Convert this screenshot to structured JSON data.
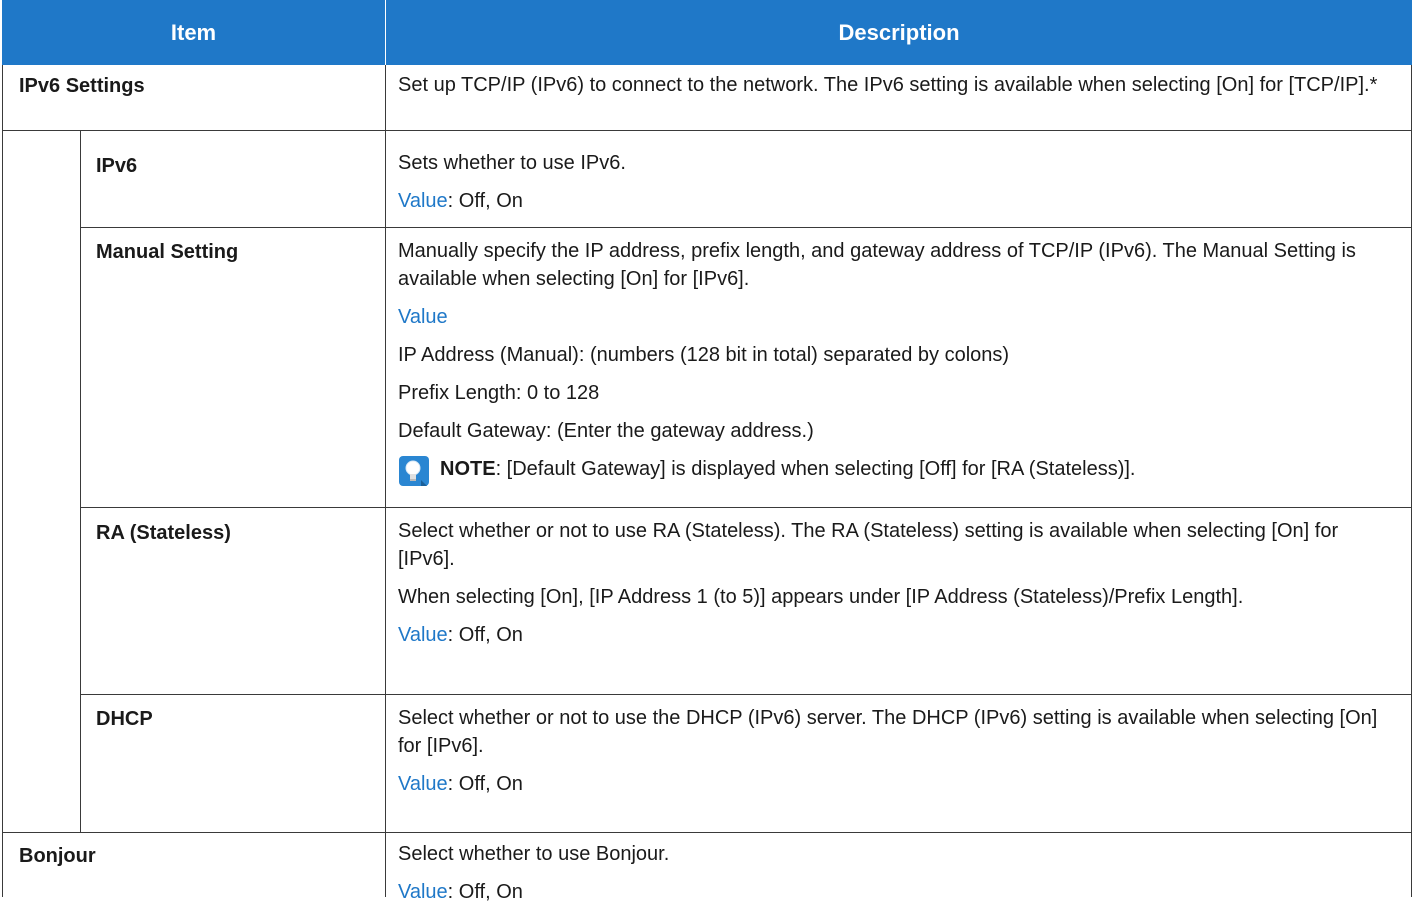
{
  "header": {
    "item": "Item",
    "description": "Description"
  },
  "value_label": "Value",
  "rows": {
    "ipv6_settings": {
      "label": "IPv6 Settings",
      "desc": "Set up TCP/IP (IPv6) to connect to the network. The IPv6 setting is available when selecting [On] for [TCP/IP].*"
    },
    "ipv6": {
      "label": "IPv6",
      "desc": "Sets whether to use IPv6.",
      "value": ": Off, On"
    },
    "manual": {
      "label": "Manual Setting",
      "desc": "Manually specify the IP address, prefix length, and gateway address of TCP/IP (IPv6). The Manual Setting is available when selecting [On] for [IPv6].",
      "value_heading": "Value",
      "lines": [
        "IP Address (Manual): (numbers (128 bit in total) separated by colons)",
        "Prefix Length: 0 to 128",
        "Default Gateway: (Enter the gateway address.)"
      ],
      "note_label": "NOTE",
      "note_text": ": [Default Gateway] is displayed when selecting [Off] for [RA (Stateless)]."
    },
    "ra": {
      "label": "RA (Stateless)",
      "desc": "Select whether or not to use RA (Stateless). The RA (Stateless) setting is available when selecting [On] for [IPv6].",
      "desc2": "When selecting [On], [IP Address 1 (to 5)] appears under [IP Address (Stateless)/Prefix Length].",
      "value": ": Off, On"
    },
    "dhcp": {
      "label": "DHCP",
      "desc": "Select whether or not to use the DHCP (IPv6) server. The DHCP (IPv6) setting is available when selecting [On] for [IPv6].",
      "value": ": Off, On"
    },
    "bonjour": {
      "label": "Bonjour",
      "desc": "Select whether to use Bonjour.",
      "value": ": Off, On"
    }
  },
  "colors": {
    "header_bg": "#1f78c8",
    "value_text": "#1f78c8",
    "border": "#3a3a3a"
  },
  "icons": {
    "note": "lightbulb-note-icon"
  }
}
